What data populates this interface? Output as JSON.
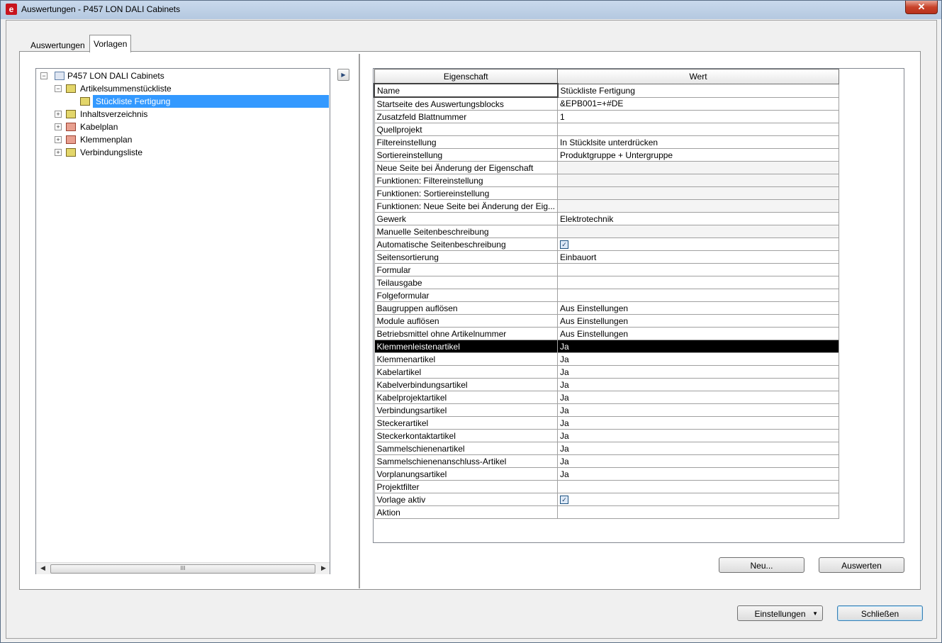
{
  "window": {
    "title": "Auswertungen - P457 LON DALI Cabinets",
    "close_label": "✕"
  },
  "tabs": [
    {
      "label": "Auswertungen"
    },
    {
      "label": "Vorlagen"
    }
  ],
  "tree": {
    "root": "P457 LON DALI Cabinets",
    "items": [
      {
        "label": "Artikelsummenstückliste"
      },
      {
        "label": "Stückliste Fertigung"
      },
      {
        "label": "Inhaltsverzeichnis"
      },
      {
        "label": "Kabelplan"
      },
      {
        "label": "Klemmenplan"
      },
      {
        "label": "Verbindungsliste"
      }
    ],
    "scroll_grip": "III"
  },
  "grid": {
    "headers": {
      "property": "Eigenschaft",
      "value": "Wert"
    },
    "rows": [
      {
        "k": "Name",
        "v": "Stückliste Fertigung"
      },
      {
        "k": "Startseite des Auswertungsblocks",
        "v": "&EPB001=+#DE"
      },
      {
        "k": "Zusatzfeld Blattnummer",
        "v": "1"
      },
      {
        "k": "Quellprojekt",
        "v": ""
      },
      {
        "k": "Filtereinstellung",
        "v": "In Stücklsite unterdrücken"
      },
      {
        "k": "Sortiereinstellung",
        "v": "Produktgruppe + Untergruppe"
      },
      {
        "k": "Neue Seite bei Änderung der Eigenschaft",
        "v": ""
      },
      {
        "k": "Funktionen: Filtereinstellung",
        "v": ""
      },
      {
        "k": "Funktionen: Sortiereinstellung",
        "v": ""
      },
      {
        "k": "Funktionen: Neue Seite bei Änderung der Eig...",
        "v": ""
      },
      {
        "k": "Gewerk",
        "v": "Elektrotechnik"
      },
      {
        "k": "Manuelle Seitenbeschreibung",
        "v": ""
      },
      {
        "k": "Automatische Seitenbeschreibung",
        "v": "",
        "checkbox": true
      },
      {
        "k": "Seitensortierung",
        "v": "Einbauort"
      },
      {
        "k": "Formular",
        "v": ""
      },
      {
        "k": "Teilausgabe",
        "v": ""
      },
      {
        "k": "Folgeformular",
        "v": ""
      },
      {
        "k": "Baugruppen auflösen",
        "v": "Aus Einstellungen"
      },
      {
        "k": "Module auflösen",
        "v": "Aus Einstellungen"
      },
      {
        "k": "Betriebsmittel ohne Artikelnummer",
        "v": "Aus Einstellungen"
      },
      {
        "k": "Klemmenleistenartikel",
        "v": "Ja"
      },
      {
        "k": "Klemmenartikel",
        "v": "Ja"
      },
      {
        "k": "Kabelartikel",
        "v": "Ja"
      },
      {
        "k": "Kabelverbindungsartikel",
        "v": "Ja"
      },
      {
        "k": "Kabelprojektartikel",
        "v": "Ja"
      },
      {
        "k": "Verbindungsartikel",
        "v": "Ja"
      },
      {
        "k": "Steckerartikel",
        "v": "Ja"
      },
      {
        "k": "Steckerkontaktartikel",
        "v": "Ja"
      },
      {
        "k": "Sammelschienenartikel",
        "v": "Ja"
      },
      {
        "k": "Sammelschienenanschluss-Artikel",
        "v": "Ja"
      },
      {
        "k": "Vorplanungsartikel",
        "v": "Ja"
      },
      {
        "k": "Projektfilter",
        "v": ""
      },
      {
        "k": "Vorlage aktiv",
        "v": "",
        "checkbox": true
      },
      {
        "k": "Aktion",
        "v": ""
      }
    ]
  },
  "buttons": {
    "new": "Neu...",
    "evaluate": "Auswerten",
    "settings": "Einstellungen",
    "close": "Schließen"
  }
}
